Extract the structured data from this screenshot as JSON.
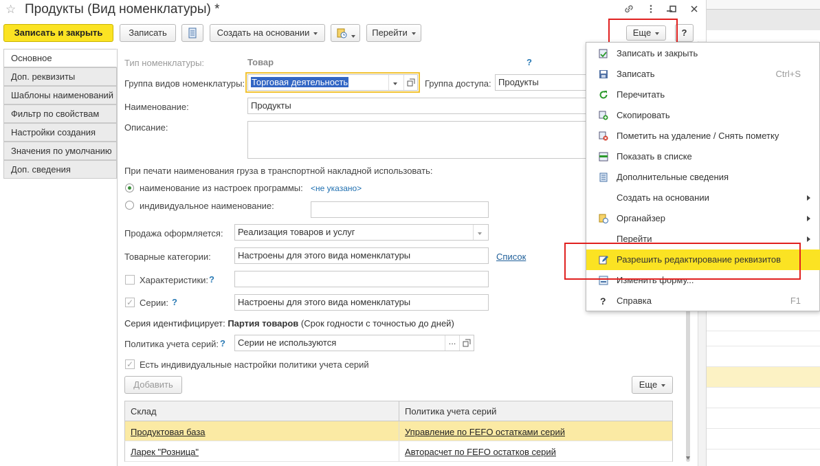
{
  "window": {
    "title": "Продукты (Вид номенклатуры) *",
    "star_glyph": "☆",
    "controls": [
      "link-icon",
      "more-vert-icon",
      "minimize-icon",
      "maximize-icon",
      "close-icon"
    ]
  },
  "toolbar": {
    "save_close": "Записать и закрыть",
    "save": "Записать",
    "create_based": "Создать на основании",
    "goto": "Перейти",
    "more": "Еще",
    "help": "?"
  },
  "nav": {
    "items": [
      "Основное",
      "Доп. реквизиты",
      "Шаблоны наименований",
      "Фильтр по свойствам",
      "Настройки создания",
      "Значения по умолчанию",
      "Доп. сведения"
    ],
    "active_index": 0
  },
  "form": {
    "type_label": "Тип номенклатуры:",
    "type_value": "Товар",
    "group_label": "Группа видов номенклатуры:",
    "group_value": "Торговая деятельность",
    "access_label": "Группа доступа:",
    "access_value": "Продукты",
    "name_label": "Наименование:",
    "name_value": "Продукты",
    "desc_label": "Описание:",
    "print_heading": "При печати наименования груза в транспортной накладной использовать:",
    "radio1_label": "наименование из настроек программы:",
    "radio1_link": "<не указано>",
    "radio2_label": "индивидуальное наименование:",
    "sale_label": "Продажа оформляется:",
    "sale_value": "Реализация товаров и услуг",
    "categories_label": "Товарные категории:",
    "categories_value": "Настроены для этого вида номенклатуры",
    "categories_link": "Список",
    "characteristics_label": "Характеристики:",
    "series_label": "Серии:",
    "series_value": "Настроены для этого вида номенклатуры",
    "series_identifies_prefix": "Серия идентифицирует:",
    "series_identifies_bold": "Партия товаров",
    "series_identifies_suffix": "(Срок годности с точностью до дней)",
    "policy_label": "Политика учета серий:",
    "policy_value": "Серии не используются",
    "individual_settings": "Есть индивидуальные настройки политики учета серий",
    "add_button": "Добавить",
    "table_more": "Еще",
    "help_mark": "?"
  },
  "table": {
    "columns": [
      "Склад",
      "Политика учета серий"
    ],
    "rows": [
      [
        "Продуктовая база",
        "Управление по FEFO остатками серий"
      ],
      [
        "Ларек \"Розница\"",
        "Авторасчет по FEFO остатков серий"
      ]
    ],
    "selected_row": 0
  },
  "menu": {
    "items": [
      {
        "label": "Записать и закрыть",
        "icon": "save-close-icon",
        "shortcut": "",
        "submenu": false
      },
      {
        "label": "Записать",
        "icon": "save-icon",
        "shortcut": "Ctrl+S",
        "submenu": false
      },
      {
        "label": "Перечитать",
        "icon": "refresh-icon",
        "shortcut": "",
        "submenu": false
      },
      {
        "label": "Скопировать",
        "icon": "copy-icon",
        "shortcut": "",
        "submenu": false
      },
      {
        "label": "Пометить на удаление / Снять пометку",
        "icon": "delete-mark-icon",
        "shortcut": "",
        "submenu": false
      },
      {
        "label": "Показать в списке",
        "icon": "show-in-list-icon",
        "shortcut": "",
        "submenu": false
      },
      {
        "label": "Дополнительные сведения",
        "icon": "info-list-icon",
        "shortcut": "",
        "submenu": false
      },
      {
        "label": "Создать на основании",
        "icon": "",
        "shortcut": "",
        "submenu": true
      },
      {
        "label": "Органайзер",
        "icon": "organizer-icon",
        "shortcut": "",
        "submenu": true
      },
      {
        "label": "Перейти",
        "icon": "",
        "shortcut": "",
        "submenu": true
      },
      {
        "label": "Разрешить редактирование реквизитов",
        "icon": "edit-icon",
        "shortcut": "",
        "submenu": false
      },
      {
        "label": "Изменить форму...",
        "icon": "form-icon",
        "shortcut": "",
        "submenu": false
      },
      {
        "label": "Справка",
        "icon": "help-icon",
        "shortcut": "F1",
        "submenu": false
      }
    ],
    "highlighted_index": 10
  },
  "colors": {
    "accent_yellow": "#fbe323",
    "highlight_red": "#e0201f",
    "link_blue": "#1f5f99",
    "selected_row": "#fbeaa4"
  }
}
